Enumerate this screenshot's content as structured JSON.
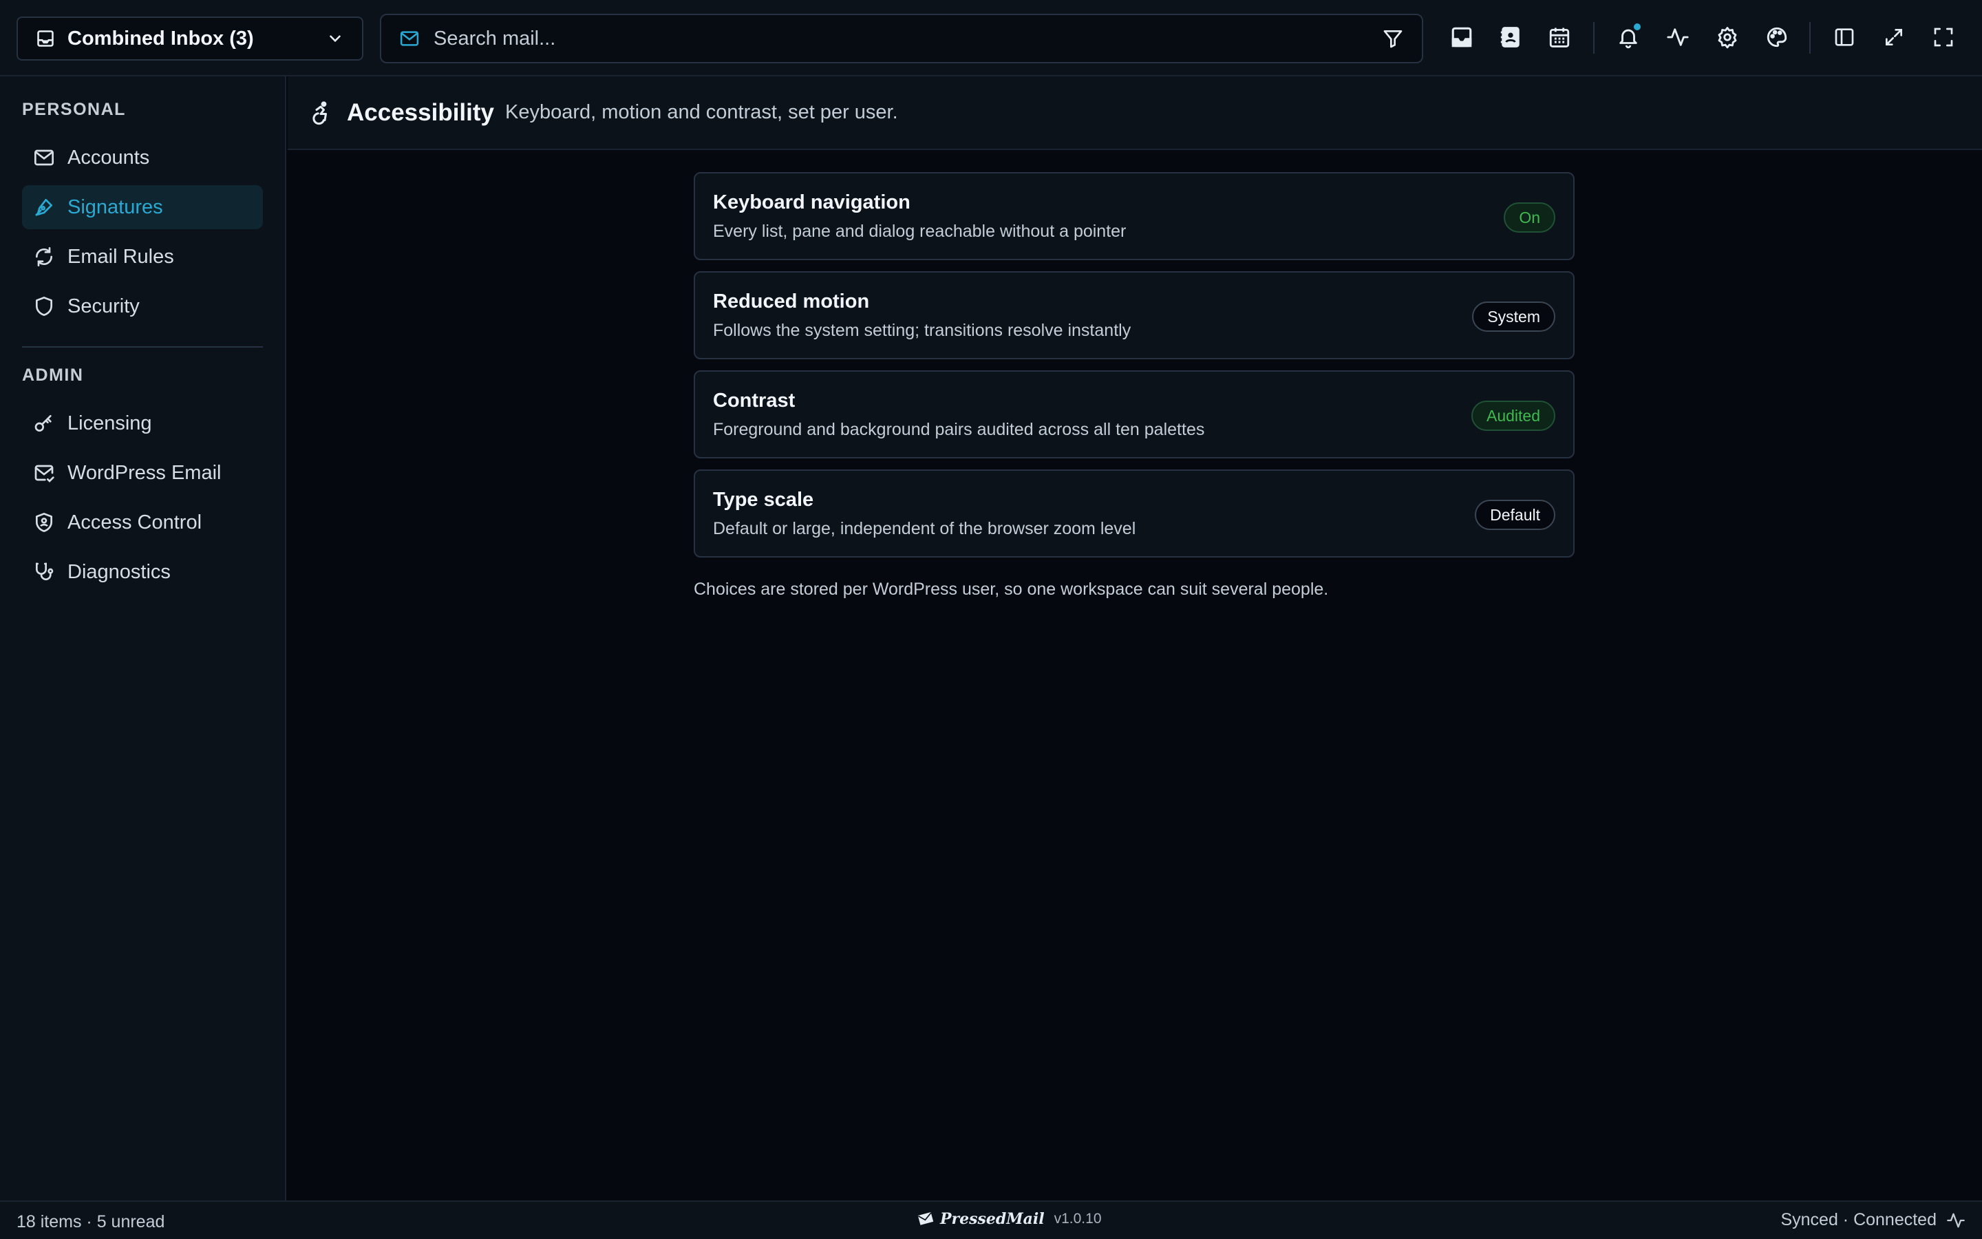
{
  "topbar": {
    "inbox_select_label": "Combined Inbox (3)",
    "search_placeholder": "Search mail...",
    "icons": [
      "inbox-icon",
      "contacts-icon",
      "calendar-icon",
      "bell-icon",
      "activity-icon",
      "gear-icon",
      "palette-icon",
      "sidebar-toggle-icon",
      "expand-icon",
      "fullscreen-icon"
    ],
    "notification_dot_color": "#2aa9d2"
  },
  "sidebar": {
    "personal_label": "PERSONAL",
    "personal_items": [
      {
        "label": "Accounts",
        "icon": "mail-icon"
      },
      {
        "label": "Signatures",
        "icon": "pen-icon",
        "active": true
      },
      {
        "label": "Email Rules",
        "icon": "refresh-icon"
      },
      {
        "label": "Security",
        "icon": "shield-icon"
      }
    ],
    "admin_label": "ADMIN",
    "admin_items": [
      {
        "label": "Licensing",
        "icon": "key-icon"
      },
      {
        "label": "WordPress Email",
        "icon": "mail-check-icon"
      },
      {
        "label": "Access Control",
        "icon": "shield-user-icon"
      },
      {
        "label": "Diagnostics",
        "icon": "stethoscope-icon"
      }
    ]
  },
  "page": {
    "title": "Accessibility",
    "subtitle": "Keyboard, motion and contrast, set per user.",
    "icon": "accessibility-icon",
    "cards": [
      {
        "title": "Keyboard navigation",
        "description": "Every list, pane and dialog reachable without a pointer",
        "badge": "On",
        "badge_style": "green"
      },
      {
        "title": "Reduced motion",
        "description": "Follows the system setting; transitions resolve instantly",
        "badge": "System",
        "badge_style": "neutral"
      },
      {
        "title": "Contrast",
        "description": "Foreground and background pairs audited across all ten palettes",
        "badge": "Audited",
        "badge_style": "green"
      },
      {
        "title": "Type scale",
        "description": "Default or large, independent of the browser zoom level",
        "badge": "Default",
        "badge_style": "neutral"
      }
    ],
    "footnote": "Choices are stored per WordPress user, so one workspace can suit several people."
  },
  "statusbar": {
    "counts": "18 items · 5 unread",
    "brand": "PressedMail",
    "version": "v1.0.10",
    "sync_status": "Synced · Connected"
  },
  "colors": {
    "accent": "#2aa9d2",
    "success": "#3fb950",
    "background": "#05090f",
    "panel": "#0b121a"
  }
}
